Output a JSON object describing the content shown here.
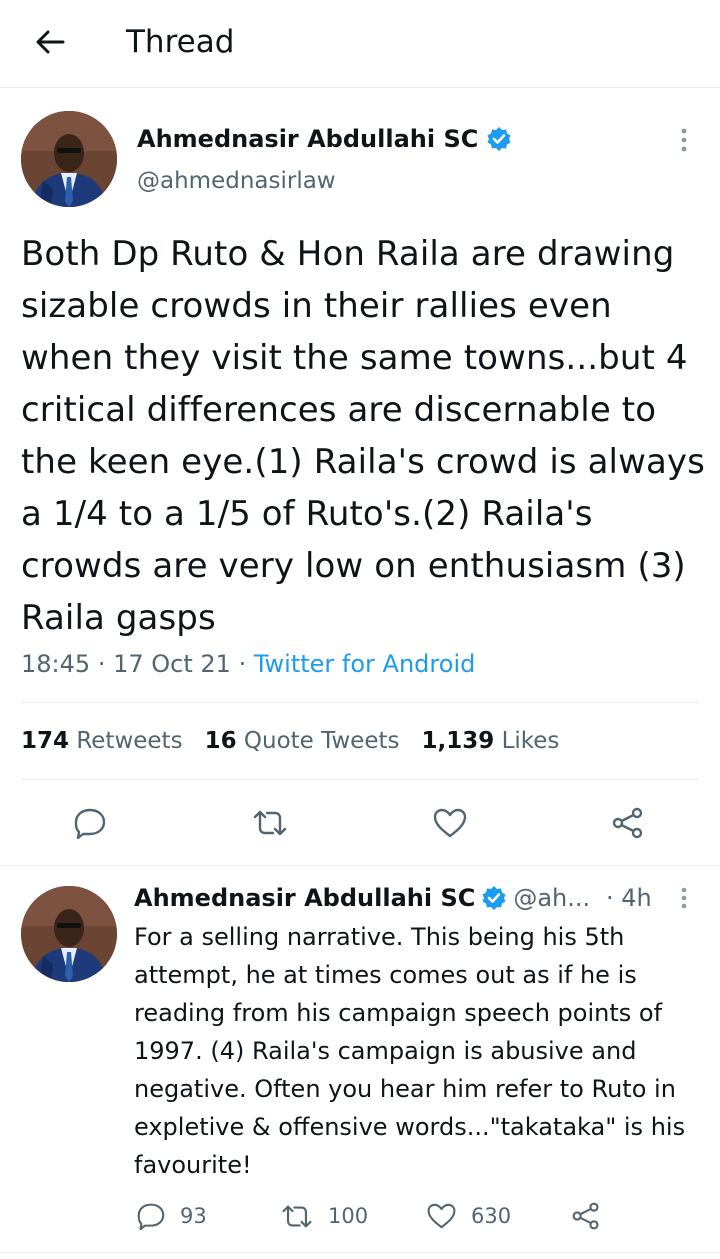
{
  "header": {
    "title": "Thread",
    "back_icon": "arrow-left-icon"
  },
  "main_tweet": {
    "author_name": "Ahmednasir Abdullahi SC",
    "handle": "@ahmednasirlaw",
    "verified": true,
    "text": "Both Dp Ruto & Hon Raila are drawing sizable crowds in their rallies even when they visit the same towns...but 4 critical differences are discernable to the keen eye.(1) Raila's crowd is always a 1/4 to a 1/5 of Ruto's.(2) Raila's crowds are very low on enthusiasm (3) Raila gasps",
    "time": "18:45",
    "date": "17 Oct 21",
    "source": "Twitter for Android",
    "separator": "·",
    "stats": {
      "retweets_count": "174",
      "retweets_label": "Retweets",
      "quotes_count": "16",
      "quotes_label": "Quote Tweets",
      "likes_count": "1,139",
      "likes_label": "Likes"
    }
  },
  "reply_tweet": {
    "author_name": "Ahmednasir Abdullahi SC",
    "handle": "@ah...",
    "time": "· 4h",
    "verified": true,
    "text": "For a selling narrative. This being his 5th attempt, he at times comes out as if he is reading from his campaign speech points of 1997. (4) Raila's campaign is abusive and negative. Often you hear him refer to Ruto in expletive & offensive words...\"takataka\" is his favourite!",
    "counts": {
      "replies": "93",
      "retweets": "100",
      "likes": "630"
    }
  },
  "colors": {
    "accent": "#1d9bf0",
    "text": "#0f1419",
    "muted": "#536471",
    "divider": "#e6ecf0"
  }
}
